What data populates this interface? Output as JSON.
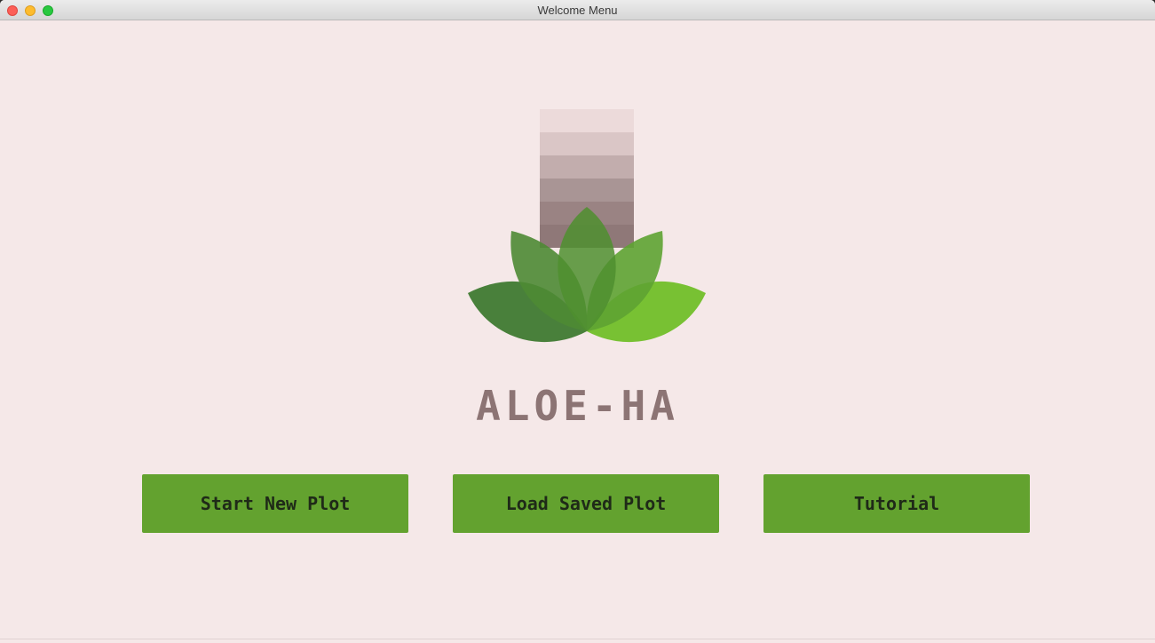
{
  "window": {
    "title": "Welcome Menu"
  },
  "logo": {
    "icon": "aloe-lotus-logo",
    "colors": {
      "bars": [
        "#ecdada",
        "#dac6c6",
        "#c2adad",
        "#a99595",
        "#9a8383",
        "#8f7878"
      ],
      "leaf_dark": "#3f7a31",
      "leaf_mid": "#4e8a34",
      "leaf_light": "#71bf29"
    }
  },
  "app": {
    "name": "ALOE-HA"
  },
  "buttons": {
    "start_new_plot": "Start New Plot",
    "load_saved_plot": "Load Saved Plot",
    "tutorial": "Tutorial"
  },
  "colors": {
    "background": "#f5e8e8",
    "button": "#63a22f",
    "button_text": "#1f2a18",
    "title_text": "#8c7474"
  }
}
